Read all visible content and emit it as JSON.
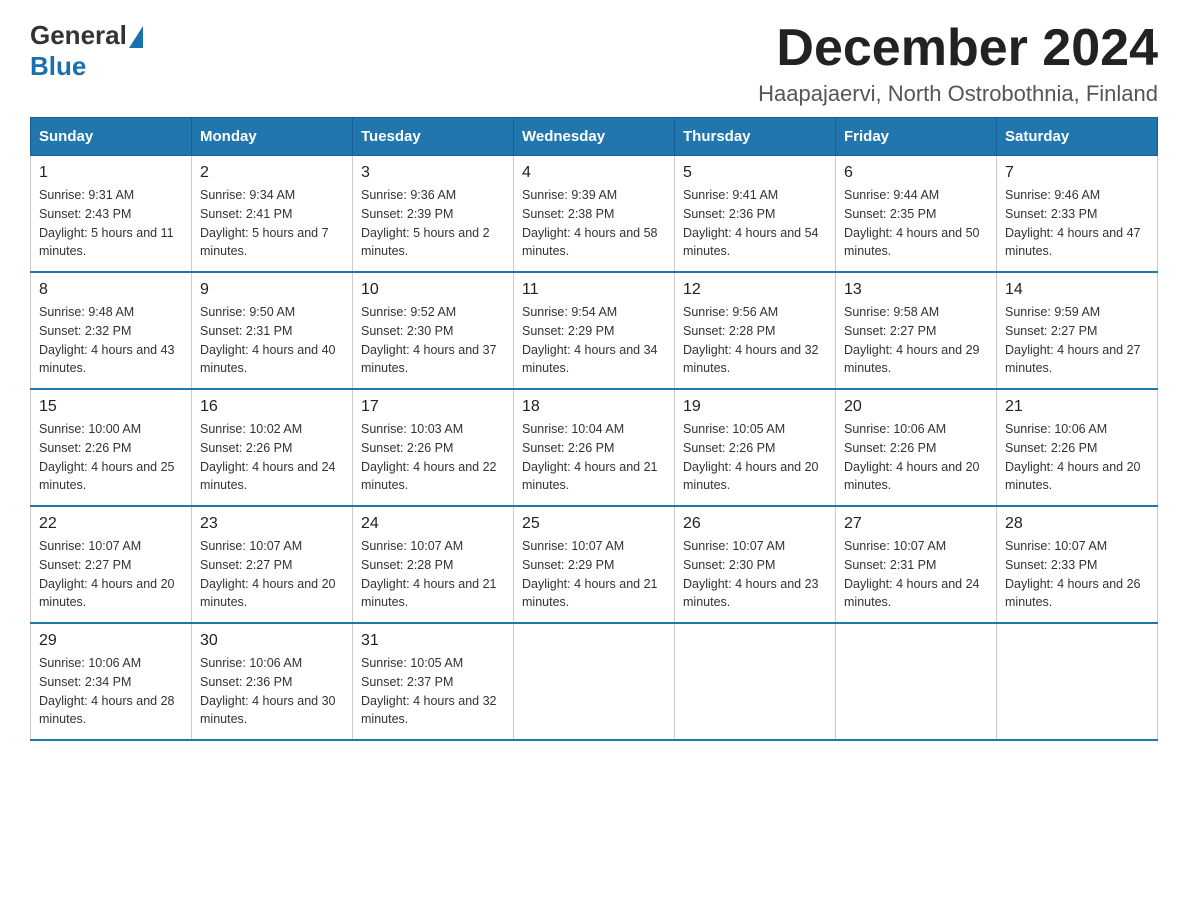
{
  "header": {
    "logo_general": "General",
    "logo_blue": "Blue",
    "month_title": "December 2024",
    "location": "Haapajaervi, North Ostrobothnia, Finland"
  },
  "weekdays": [
    "Sunday",
    "Monday",
    "Tuesday",
    "Wednesday",
    "Thursday",
    "Friday",
    "Saturday"
  ],
  "weeks": [
    [
      {
        "day": "1",
        "sunrise": "9:31 AM",
        "sunset": "2:43 PM",
        "daylight": "5 hours and 11 minutes."
      },
      {
        "day": "2",
        "sunrise": "9:34 AM",
        "sunset": "2:41 PM",
        "daylight": "5 hours and 7 minutes."
      },
      {
        "day": "3",
        "sunrise": "9:36 AM",
        "sunset": "2:39 PM",
        "daylight": "5 hours and 2 minutes."
      },
      {
        "day": "4",
        "sunrise": "9:39 AM",
        "sunset": "2:38 PM",
        "daylight": "4 hours and 58 minutes."
      },
      {
        "day": "5",
        "sunrise": "9:41 AM",
        "sunset": "2:36 PM",
        "daylight": "4 hours and 54 minutes."
      },
      {
        "day": "6",
        "sunrise": "9:44 AM",
        "sunset": "2:35 PM",
        "daylight": "4 hours and 50 minutes."
      },
      {
        "day": "7",
        "sunrise": "9:46 AM",
        "sunset": "2:33 PM",
        "daylight": "4 hours and 47 minutes."
      }
    ],
    [
      {
        "day": "8",
        "sunrise": "9:48 AM",
        "sunset": "2:32 PM",
        "daylight": "4 hours and 43 minutes."
      },
      {
        "day": "9",
        "sunrise": "9:50 AM",
        "sunset": "2:31 PM",
        "daylight": "4 hours and 40 minutes."
      },
      {
        "day": "10",
        "sunrise": "9:52 AM",
        "sunset": "2:30 PM",
        "daylight": "4 hours and 37 minutes."
      },
      {
        "day": "11",
        "sunrise": "9:54 AM",
        "sunset": "2:29 PM",
        "daylight": "4 hours and 34 minutes."
      },
      {
        "day": "12",
        "sunrise": "9:56 AM",
        "sunset": "2:28 PM",
        "daylight": "4 hours and 32 minutes."
      },
      {
        "day": "13",
        "sunrise": "9:58 AM",
        "sunset": "2:27 PM",
        "daylight": "4 hours and 29 minutes."
      },
      {
        "day": "14",
        "sunrise": "9:59 AM",
        "sunset": "2:27 PM",
        "daylight": "4 hours and 27 minutes."
      }
    ],
    [
      {
        "day": "15",
        "sunrise": "10:00 AM",
        "sunset": "2:26 PM",
        "daylight": "4 hours and 25 minutes."
      },
      {
        "day": "16",
        "sunrise": "10:02 AM",
        "sunset": "2:26 PM",
        "daylight": "4 hours and 24 minutes."
      },
      {
        "day": "17",
        "sunrise": "10:03 AM",
        "sunset": "2:26 PM",
        "daylight": "4 hours and 22 minutes."
      },
      {
        "day": "18",
        "sunrise": "10:04 AM",
        "sunset": "2:26 PM",
        "daylight": "4 hours and 21 minutes."
      },
      {
        "day": "19",
        "sunrise": "10:05 AM",
        "sunset": "2:26 PM",
        "daylight": "4 hours and 20 minutes."
      },
      {
        "day": "20",
        "sunrise": "10:06 AM",
        "sunset": "2:26 PM",
        "daylight": "4 hours and 20 minutes."
      },
      {
        "day": "21",
        "sunrise": "10:06 AM",
        "sunset": "2:26 PM",
        "daylight": "4 hours and 20 minutes."
      }
    ],
    [
      {
        "day": "22",
        "sunrise": "10:07 AM",
        "sunset": "2:27 PM",
        "daylight": "4 hours and 20 minutes."
      },
      {
        "day": "23",
        "sunrise": "10:07 AM",
        "sunset": "2:27 PM",
        "daylight": "4 hours and 20 minutes."
      },
      {
        "day": "24",
        "sunrise": "10:07 AM",
        "sunset": "2:28 PM",
        "daylight": "4 hours and 21 minutes."
      },
      {
        "day": "25",
        "sunrise": "10:07 AM",
        "sunset": "2:29 PM",
        "daylight": "4 hours and 21 minutes."
      },
      {
        "day": "26",
        "sunrise": "10:07 AM",
        "sunset": "2:30 PM",
        "daylight": "4 hours and 23 minutes."
      },
      {
        "day": "27",
        "sunrise": "10:07 AM",
        "sunset": "2:31 PM",
        "daylight": "4 hours and 24 minutes."
      },
      {
        "day": "28",
        "sunrise": "10:07 AM",
        "sunset": "2:33 PM",
        "daylight": "4 hours and 26 minutes."
      }
    ],
    [
      {
        "day": "29",
        "sunrise": "10:06 AM",
        "sunset": "2:34 PM",
        "daylight": "4 hours and 28 minutes."
      },
      {
        "day": "30",
        "sunrise": "10:06 AM",
        "sunset": "2:36 PM",
        "daylight": "4 hours and 30 minutes."
      },
      {
        "day": "31",
        "sunrise": "10:05 AM",
        "sunset": "2:37 PM",
        "daylight": "4 hours and 32 minutes."
      },
      null,
      null,
      null,
      null
    ]
  ]
}
